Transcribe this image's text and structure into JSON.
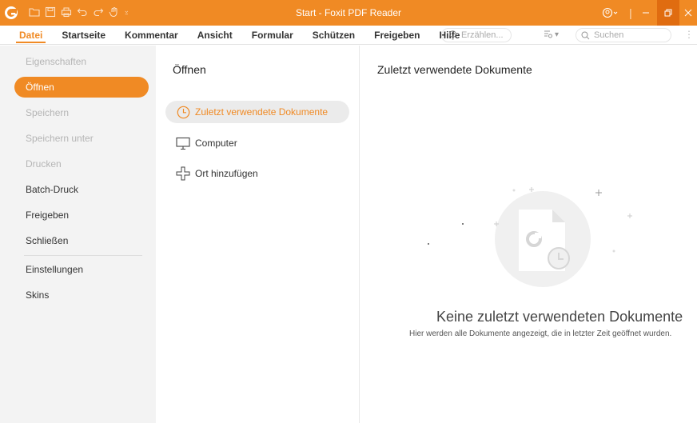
{
  "window": {
    "title": "Start - Foxit PDF Reader"
  },
  "menu": {
    "items": [
      "Datei",
      "Startseite",
      "Kommentar",
      "Ansicht",
      "Formular",
      "Schützen",
      "Freigeben",
      "Hilfe"
    ],
    "tell_me_placeholder": "Erzählen...",
    "search_placeholder": "Suchen"
  },
  "nav": {
    "items": [
      {
        "label": "Eigenschaften",
        "state": "disabled"
      },
      {
        "label": "Öffnen",
        "state": "selected"
      },
      {
        "label": "Speichern",
        "state": "disabled"
      },
      {
        "label": "Speichern unter",
        "state": "disabled"
      },
      {
        "label": "Drucken",
        "state": "disabled"
      },
      {
        "label": "Batch-Druck",
        "state": "normal"
      },
      {
        "label": "Freigeben",
        "state": "normal"
      },
      {
        "label": "Schließen",
        "state": "normal"
      },
      {
        "label": "Einstellungen",
        "state": "normal"
      },
      {
        "label": "Skins",
        "state": "normal"
      }
    ]
  },
  "open_panel": {
    "title": "Öffnen",
    "options": [
      {
        "label": "Zuletzt verwendete Dokumente",
        "icon": "clock-icon",
        "selected": true
      },
      {
        "label": "Computer",
        "icon": "monitor-icon",
        "selected": false
      },
      {
        "label": "Ort hinzufügen",
        "icon": "plus-icon",
        "selected": false
      }
    ]
  },
  "recent_panel": {
    "title": "Zuletzt verwendete Dokumente",
    "empty_title": "Keine zuletzt verwendeten Dokumente",
    "empty_subtitle": "Hier werden alle Dokumente angezeigt, die in letzter Zeit geöffnet wurden."
  },
  "colors": {
    "accent": "#f08a24",
    "nav_bg": "#f3f3f3"
  }
}
